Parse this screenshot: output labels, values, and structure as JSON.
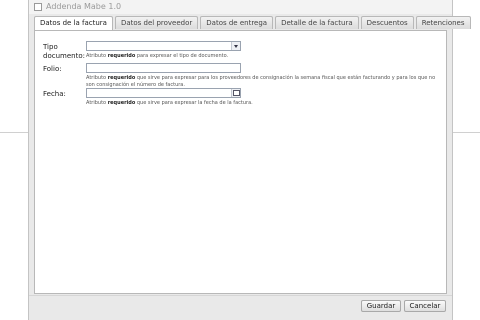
{
  "window": {
    "title": "Addenda Mabe 1.0"
  },
  "tabs": [
    {
      "label": "Datos de la factura"
    },
    {
      "label": "Datos del proveedor"
    },
    {
      "label": "Datos de entrega"
    },
    {
      "label": "Detalle de la factura"
    },
    {
      "label": "Descuentos"
    },
    {
      "label": "Retenciones"
    }
  ],
  "active_tab": "Datos de la factura",
  "form": {
    "tipo_documento": {
      "label": "Tipo documento:",
      "value": "",
      "help_bold": "requerido",
      "help_pre": "Atributo ",
      "help_post": " para expresar el tipo de documento."
    },
    "folio": {
      "label": "Folio:",
      "value": "",
      "help_bold": "requerido",
      "help_pre": "Atributo ",
      "help_post": " que sirve para expresar para los proveedores de consignación la semana fiscal que están facturando y para los que no son consignación el número de factura."
    },
    "fecha": {
      "label": "Fecha:",
      "value": "",
      "help_bold": "requerido",
      "help_pre": "Atributo ",
      "help_post": " que sirve para expresar la fecha de la factura."
    }
  },
  "footer": {
    "save_label": "Guardar",
    "cancel_label": "Cancelar"
  },
  "icons": {
    "window": "window-icon",
    "dropdown": "chevron-down-icon",
    "calendar": "calendar-icon"
  },
  "colors": {
    "window_bg": "#e9e9e9",
    "panel_bg": "#ffffff",
    "border": "#b8b8b8",
    "input_border": "#9aa3b0"
  }
}
